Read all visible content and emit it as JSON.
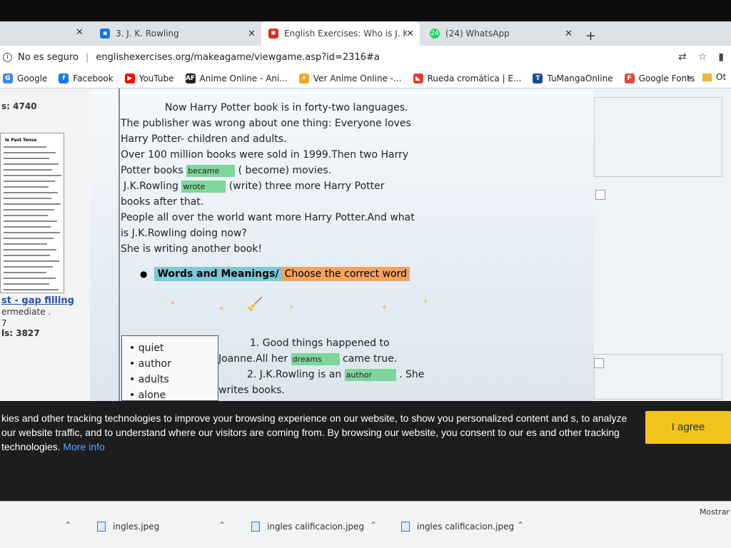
{
  "tabs": [
    {
      "title": "3. J. K. Rowling",
      "icon": "document-icon",
      "color": "#1a73e8",
      "active": false
    },
    {
      "title": "English Exercises: Who is J. K. Ro",
      "icon": "englishexercises-icon",
      "color": "#d93025",
      "active": true
    },
    {
      "title": "(24) WhatsApp",
      "icon": "whatsapp-icon",
      "badge": "24",
      "color": "#25d366",
      "active": false
    }
  ],
  "address": {
    "security": "No es seguro",
    "url": "englishexercises.org/makeagame/viewgame.asp?id=2316#a"
  },
  "bookmarks": [
    {
      "label": "Google",
      "icon": "google-icon",
      "glyph": "G",
      "color": "#4285f4"
    },
    {
      "label": "Facebook",
      "icon": "facebook-icon",
      "glyph": "f",
      "color": "#1877f2"
    },
    {
      "label": "YouTube",
      "icon": "youtube-icon",
      "glyph": "▶",
      "color": "#ff0000"
    },
    {
      "label": "Anime Online - Ani...",
      "icon": "anime-online-icon",
      "glyph": "AF",
      "color": "#222222"
    },
    {
      "label": "Ver Anime Online -...",
      "icon": "ver-anime-icon",
      "glyph": "✦",
      "color": "#f5a623"
    },
    {
      "label": "Rueda cromática | E...",
      "icon": "rueda-icon",
      "glyph": "◣",
      "color": "#e53935"
    },
    {
      "label": "TuMangaOnline",
      "icon": "tumanga-icon",
      "glyph": "T",
      "color": "#1a4a9a"
    },
    {
      "label": "Google Fonts",
      "icon": "google-fonts-icon",
      "glyph": "F",
      "color": "#ea4335"
    }
  ],
  "bookmarks_overflow": "»",
  "bookmarks_other": "Ot",
  "left": {
    "stat1": "s: 4740",
    "thumb_title": "le Past Tense",
    "link": "st - gap filling",
    "level": "ermediate  .",
    "num": "7",
    "stat2": "ls: 3827"
  },
  "reading": {
    "line1": "Now Harry Potter book is in forty-two languages.",
    "line2": "The publisher was wrong about one thing: Everyone loves",
    "line3": "Harry Potter- children and adults.",
    "line4": "Over 100 million books were sold in 1999.Then two Harry",
    "line5_a": "Potter books",
    "gap1": "became",
    "line5_b": "( become) movies.",
    "line6_a": "J.K.Rowling",
    "gap2": "wrote",
    "line6_b": "(write)  three more Harry Potter",
    "line7": "books after that.",
    "line8": "People all over the world want more Harry Potter.And what",
    "line9": "is J.K.Rowling doing now?",
    "line10": "She is writing another book!"
  },
  "heading": {
    "part1": "Words and Meanings/",
    "part2": "Choose the correct word"
  },
  "wordbox": [
    "quiet",
    "author",
    "adults",
    "alone"
  ],
  "exercises": {
    "q1": "1.  Good things happened to",
    "q1b": "Joanne.All her",
    "gap3": "dreams",
    "q1c": "came true.",
    "q2": "2. J.K.Rowling is an",
    "gap4": "author",
    "q2b": ". She",
    "q2c": "writes books."
  },
  "cookie": {
    "text": "kies and other tracking technologies to improve your browsing experience on our website, to show you personalized content and s, to analyze our website traffic, and to understand where our visitors are coming from. By browsing our website, you consent to our es and other tracking technologies.",
    "more": "More info",
    "agree": "I agree"
  },
  "downloads": {
    "files": [
      "ingles.jpeg",
      "ingles calificacion.jpeg",
      "ingles calificacion.jpeg"
    ],
    "show_all": "Mostrar"
  }
}
